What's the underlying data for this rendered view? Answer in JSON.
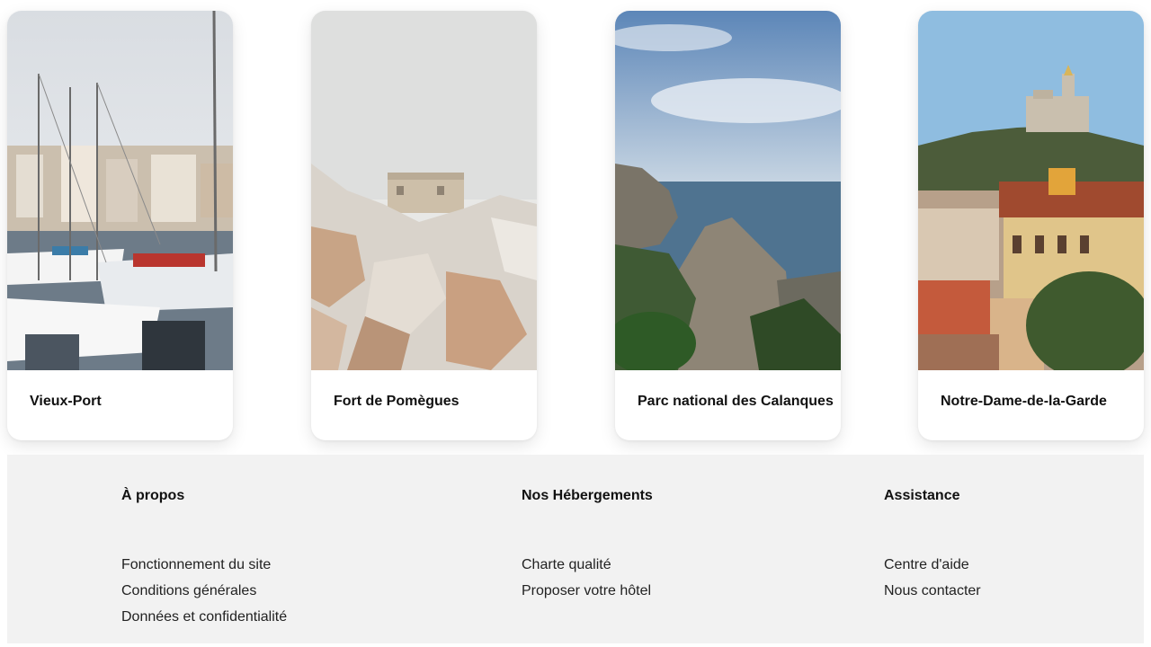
{
  "destinations": [
    {
      "name": "Vieux-Port",
      "image": "vieux-port-marina-photo"
    },
    {
      "name": "Fort de Pomègues",
      "image": "fort-de-pomegues-rocks-photo"
    },
    {
      "name": "Parc national des Calanques",
      "image": "calanques-coastline-photo"
    },
    {
      "name": "Notre-Dame-de-la-Garde",
      "image": "notre-dame-de-la-garde-hill-photo"
    }
  ],
  "footer": {
    "columns": [
      {
        "title": "À propos",
        "links": [
          "Fonctionnement du site",
          "Conditions générales",
          "Données et confidentialité"
        ]
      },
      {
        "title": "Nos Hébergements",
        "links": [
          "Charte qualité",
          "Proposer votre hôtel"
        ]
      },
      {
        "title": "Assistance",
        "links": [
          "Centre d'aide",
          "Nous contacter"
        ]
      }
    ]
  }
}
